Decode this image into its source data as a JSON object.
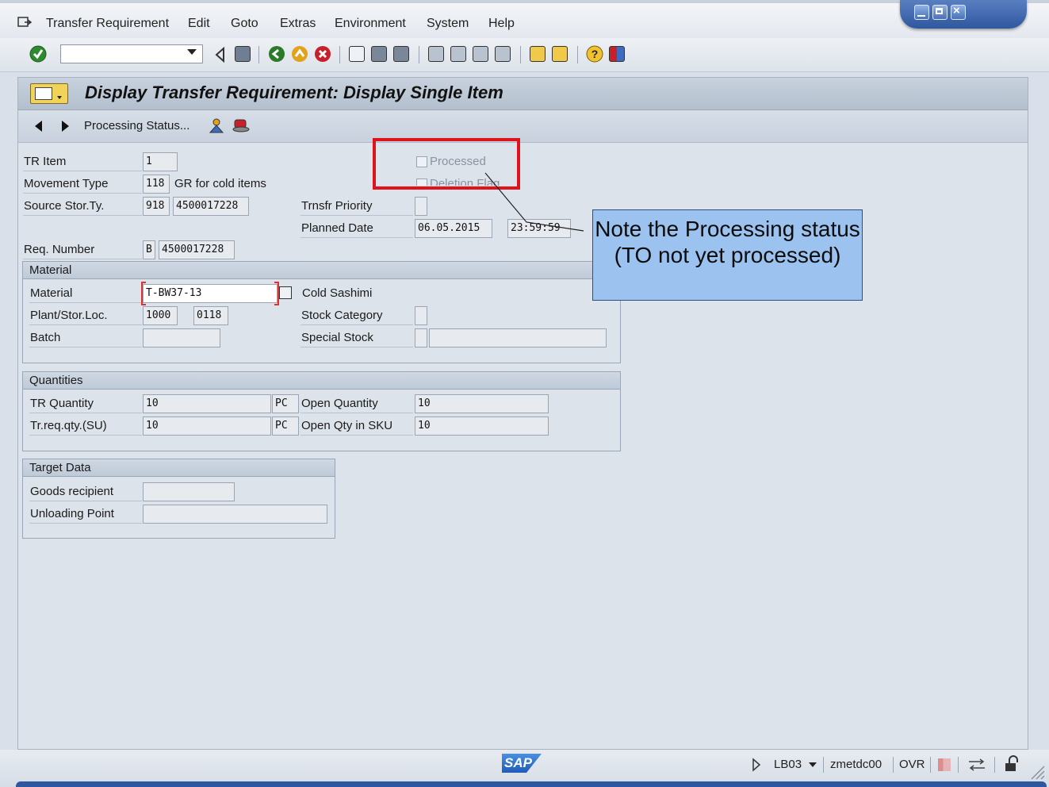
{
  "menu": {
    "items": [
      "Transfer Requirement",
      "Edit",
      "Goto",
      "Extras",
      "Environment",
      "System",
      "Help"
    ]
  },
  "toolbar": {
    "command_value": "",
    "icons": [
      "enter-icon",
      "back-icon",
      "save-icon",
      "back-green-icon",
      "exit-icon",
      "cancel-icon",
      "print-icon",
      "find-icon",
      "find-next-icon",
      "first-page-icon",
      "previous-page-icon",
      "next-page-icon",
      "last-page-icon",
      "create-session-icon",
      "shortcut-icon",
      "help-icon",
      "layout-menu-icon"
    ]
  },
  "title": "Display Transfer Requirement: Display Single Item",
  "app_toolbar": {
    "processing_status": "Processing Status..."
  },
  "header_fields": {
    "tr_item": {
      "label": "TR Item",
      "value": "1"
    },
    "movement_type": {
      "label": "Movement Type",
      "value": "118",
      "description": "GR for cold items"
    },
    "source_stor_ty": {
      "label": "Source Stor.Ty.",
      "value": "918",
      "extra": "4500017228"
    },
    "req_number": {
      "label": "Req. Number",
      "value": "B",
      "extra": "4500017228"
    },
    "processed": {
      "label": "Processed",
      "checked": false
    },
    "deletion_flag": {
      "label": "Deletion Flag",
      "checked": false
    },
    "trnsfr_priority": {
      "label": "Trnsfr Priority",
      "value": ""
    },
    "planned_date": {
      "label": "Planned Date",
      "date": "06.05.2015",
      "time": "23:59:59"
    }
  },
  "material_group": {
    "title": "Material",
    "material": {
      "label": "Material",
      "value": "T-BW37-13",
      "description": "Cold Sashimi"
    },
    "plant_stor_loc": {
      "label": "Plant/Stor.Loc.",
      "plant": "1000",
      "stor_loc": "0118"
    },
    "batch": {
      "label": "Batch",
      "value": ""
    },
    "stock_category": {
      "label": "Stock Category",
      "value": ""
    },
    "special_stock": {
      "label": "Special Stock",
      "value": "",
      "extra": ""
    }
  },
  "quantities_group": {
    "title": "Quantities",
    "tr_quantity": {
      "label": "TR Quantity",
      "value": "10",
      "unit": "PC"
    },
    "tr_req_qty_su": {
      "label": "Tr.req.qty.(SU)",
      "value": "10",
      "unit": "PC"
    },
    "open_quantity": {
      "label": "Open Quantity",
      "value": "10"
    },
    "open_qty_sku": {
      "label": "Open Qty in SKU",
      "value": "10"
    }
  },
  "target_group": {
    "title": "Target Data",
    "goods_recipient": {
      "label": "Goods recipient",
      "value": ""
    },
    "unloading_point": {
      "label": "Unloading Point",
      "value": ""
    }
  },
  "annotation": {
    "text": "Note the Processing status (TO not yet processed)"
  },
  "status_bar": {
    "logo": "SAP",
    "transaction": "LB03",
    "server": "zmetdc00",
    "mode": "OVR"
  },
  "colors": {
    "highlight_box": "#e0121b",
    "callout_fill": "#9cc2f0",
    "window_blue": "#2f579f"
  }
}
